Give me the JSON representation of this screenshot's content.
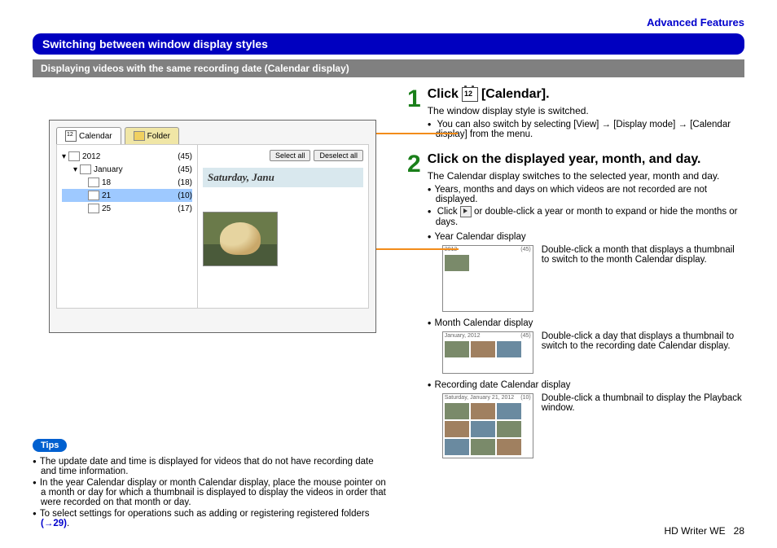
{
  "header": {
    "section_link": "Advanced Features"
  },
  "blue_bar": "Switching between window display styles",
  "grey_bar": "Displaying videos with the same recording date (Calendar display)",
  "screenshot": {
    "tabs": {
      "calendar": "Calendar",
      "folder": "Folder"
    },
    "buttons": {
      "select_all": "Select all",
      "deselect_all": "Deselect all"
    },
    "tree": {
      "year": {
        "label": "2012",
        "count": "(45)"
      },
      "month": {
        "label": "January",
        "count": "(45)"
      },
      "days": [
        {
          "label": "18",
          "count": "(18)"
        },
        {
          "label": "21",
          "count": "(10)",
          "selected": true
        },
        {
          "label": "25",
          "count": "(17)"
        }
      ]
    },
    "date_title": "Saturday, Janu"
  },
  "steps": {
    "s1": {
      "num": "1",
      "title_a": "Click",
      "title_b": "[Calendar].",
      "line1": "The window display style is switched.",
      "bullet1_a": "You can also switch by selecting [View] ",
      "bullet1_b": " [Display mode] ",
      "bullet1_c": " [Calendar display] from the menu."
    },
    "s2": {
      "num": "2",
      "title": "Click on the displayed year, month, and day.",
      "line1": "The Calendar display switches to the selected year, month and day.",
      "bullet1": "Years, months and days on which videos are not recorded are not displayed.",
      "bullet2_a": "Click ",
      "bullet2_b": " or double-click a year or month to expand or hide the months or days.",
      "year_label": "Year Calendar display",
      "year_text": "Double-click a month that displays a thumbnail to switch to the month Calendar display.",
      "month_label": "Month Calendar display",
      "month_text": "Double-click a day that displays a thumbnail to switch to the recording date Calendar display.",
      "rec_label": "Recording date Calendar display",
      "rec_text": "Double-click a thumbnail to display the Playback window."
    }
  },
  "tips": {
    "label": "Tips",
    "items": [
      "The update date and time is displayed for videos that do not have recording date and time information.",
      "In the year Calendar display or month Calendar display, place the mouse pointer on a month or day for which a thumbnail is displayed to display the videos in order that were recorded on that month or day.",
      "To select settings for operations such as adding or registering registered folders "
    ],
    "link": "(→29)"
  },
  "footer": {
    "product": "HD Writer WE",
    "page": "28"
  },
  "mini_headers": {
    "year": "2012",
    "month_a": "January, 2012",
    "day_a": "Saturday, January 21, 2012",
    "count45": "(45)",
    "count10": "(10)"
  }
}
